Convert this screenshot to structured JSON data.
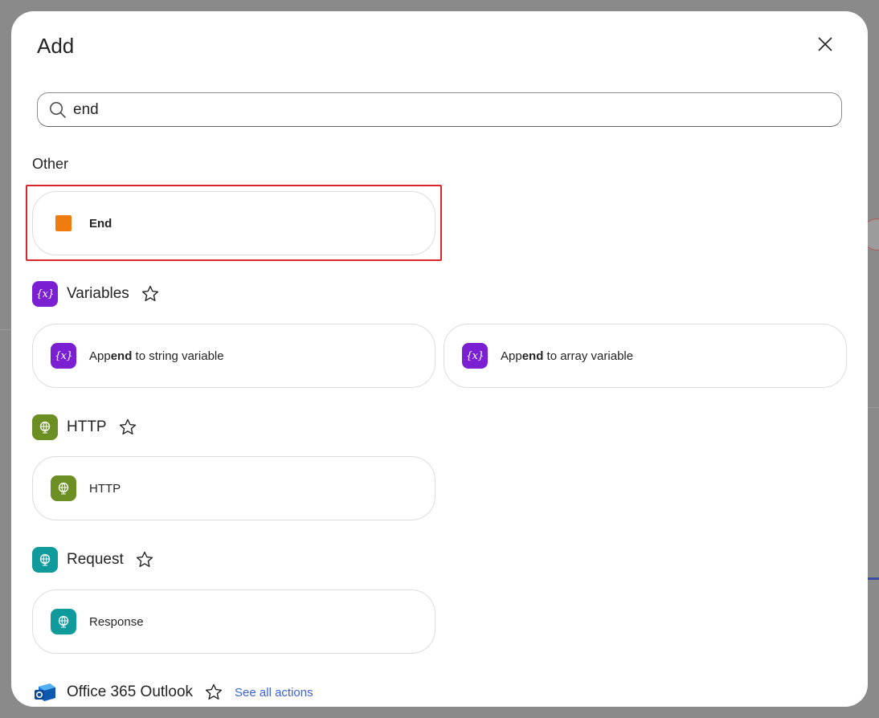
{
  "dialog": {
    "title": "Add",
    "close_label": "Close"
  },
  "search": {
    "value": "end",
    "placeholder": "Search"
  },
  "sections": {
    "other": {
      "label": "Other",
      "items": [
        {
          "label": "End",
          "icon": "stop-square-icon",
          "color": "#f07c10"
        }
      ]
    },
    "variables": {
      "title": "Variables",
      "icon": "variable-icon",
      "color": "#7a1fd1",
      "items": [
        {
          "pre": "App",
          "match": "end",
          "post": " to string variable"
        },
        {
          "pre": "App",
          "match": "end",
          "post": " to array variable"
        }
      ]
    },
    "http": {
      "title": "HTTP",
      "icon": "globe-icon",
      "color": "#6b8f23",
      "items": [
        {
          "label": "HTTP"
        }
      ]
    },
    "request": {
      "title": "Request",
      "icon": "globe-icon",
      "color": "#0f9a9c",
      "items": [
        {
          "label": "Response"
        }
      ]
    },
    "outlook": {
      "title": "Office 365 Outlook",
      "icon": "outlook-icon",
      "see_all": "See all actions"
    }
  },
  "colors": {
    "highlight_border": "#d9262b",
    "link": "#3b63d6"
  }
}
